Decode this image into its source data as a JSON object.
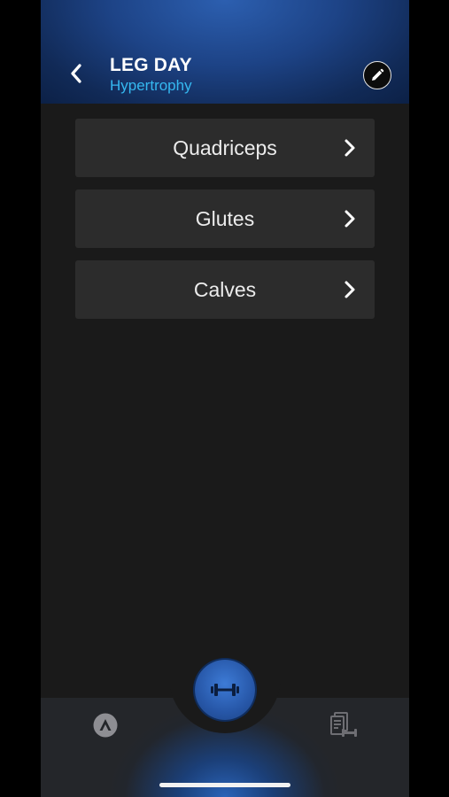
{
  "header": {
    "title": "LEG DAY",
    "subtitle": "Hypertrophy",
    "back_icon": "chevron-left-icon",
    "edit_icon": "pencil-icon"
  },
  "muscle_groups": [
    {
      "label": "Quadriceps"
    },
    {
      "label": "Glutes"
    },
    {
      "label": "Calves"
    }
  ],
  "tabbar": {
    "left_icon": "app-logo-icon",
    "center_icon": "dumbbell-icon",
    "right_icon": "workout-log-icon"
  },
  "colors": {
    "accent": "#35b8f0",
    "header_blue": "#1d4386",
    "background": "#1a1a1a",
    "card": "#2c2c2c",
    "fab_blue": "#2757a8"
  }
}
